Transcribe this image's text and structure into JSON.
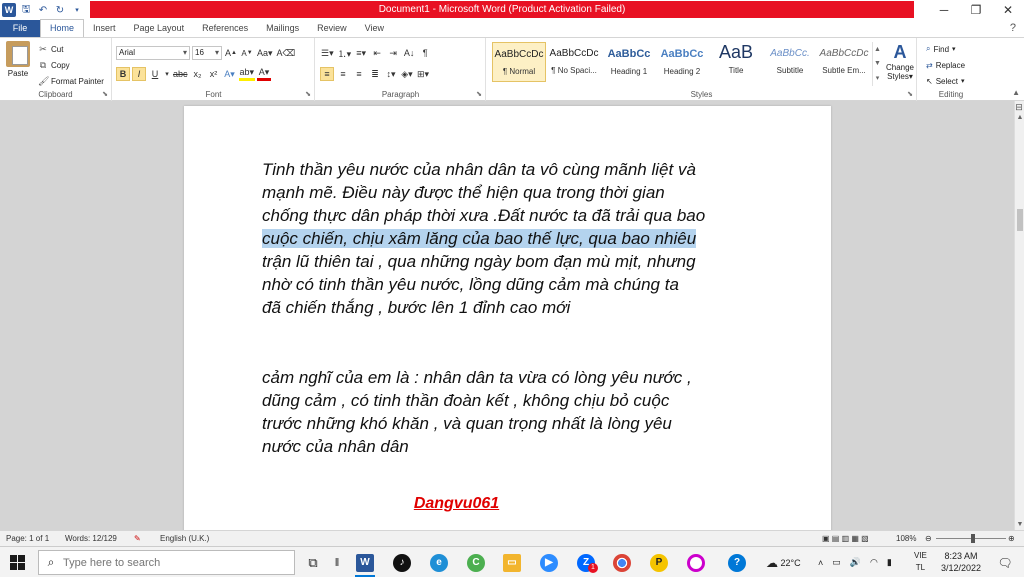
{
  "window": {
    "title": "Document1 - Microsoft Word (Product Activation Failed)"
  },
  "tabs": [
    "File",
    "Home",
    "Insert",
    "Page Layout",
    "References",
    "Mailings",
    "Review",
    "View"
  ],
  "clipboard": {
    "paste": "Paste",
    "cut": "Cut",
    "copy": "Copy",
    "format_painter": "Format Painter",
    "label": "Clipboard"
  },
  "font": {
    "name": "Arial",
    "size": "16",
    "label": "Font"
  },
  "paragraph": {
    "label": "Paragraph"
  },
  "styles": {
    "label": "Styles",
    "items": [
      {
        "sample": "AaBbCcDc",
        "name": "¶ Normal"
      },
      {
        "sample": "AaBbCcDc",
        "name": "¶ No Spaci..."
      },
      {
        "sample": "AaBbCc",
        "name": "Heading 1"
      },
      {
        "sample": "AaBbCc",
        "name": "Heading 2"
      },
      {
        "sample": "AaB",
        "name": "Title"
      },
      {
        "sample": "AaBbCc.",
        "name": "Subtitle"
      },
      {
        "sample": "AaBbCcDc",
        "name": "Subtle Em..."
      }
    ],
    "change_styles": [
      "Change",
      "Styles"
    ]
  },
  "editing": {
    "find": "Find",
    "replace": "Replace",
    "select": "Select",
    "label": "Editing"
  },
  "document": {
    "para1": [
      "Tinh thần yêu nước của nhân dân ta vô cùng mãnh liệt và",
      "mạnh mẽ. Điều này được thể hiện qua trong thời gian",
      "chống thực dân pháp thời xưa .Đất nước ta đã trải qua bao",
      "cuộc chiến, chịu xâm lăng của bao thế lực, qua bao nhiêu",
      "trận lũ thiên tai , qua những ngày bom đạn mù mịt, nhưng",
      "nhờ có tinh thần yêu nước, lồng dũng cảm mà  chúng ta",
      "đã chiến thắng , bước lên 1 đỉnh cao mới"
    ],
    "para2": [
      "cảm nghĩ của em là : nhân dân ta vừa có lòng yêu nước ,",
      "dũng cảm , có tinh thần đoàn kết , không chịu bỏ cuộc",
      "trước những khó khăn , và quan trọng nhất là lòng yêu",
      "nước của nhân dân"
    ],
    "signature": "Dangvu061"
  },
  "status": {
    "page": "Page: 1 of 1",
    "words": "Words: 12/129",
    "language": "English (U.K.)",
    "zoom": "108%"
  },
  "taskbar": {
    "search_placeholder": "Type here to search",
    "weather": "22°C",
    "lang": "VIE",
    "lang2": "TL",
    "time": "8:23 AM",
    "date": "3/12/2022",
    "badge": "1"
  }
}
